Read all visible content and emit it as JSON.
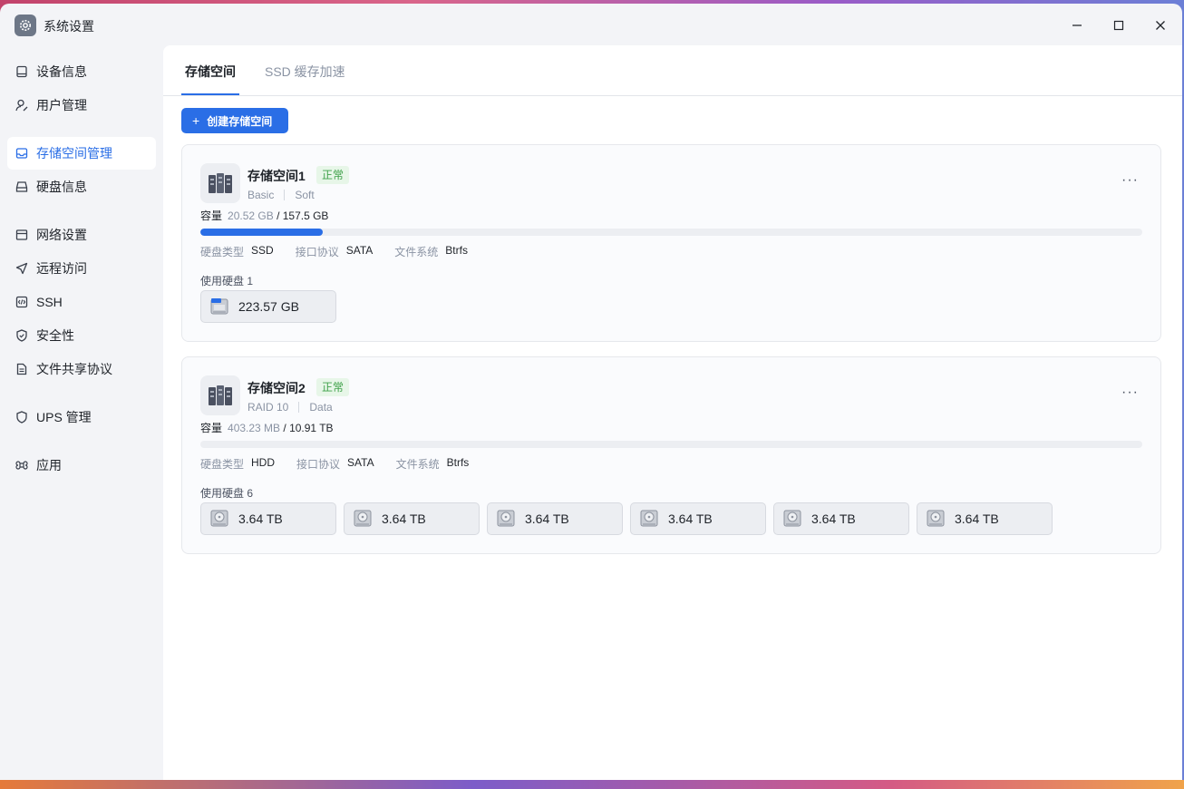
{
  "app": {
    "title": "系统设置",
    "icon": "gear-icon"
  },
  "window_controls": {
    "minimize": "minimize-icon",
    "maximize": "maximize-icon",
    "close": "close-icon"
  },
  "sidebar": {
    "items": [
      {
        "label": "设备信息",
        "icon": "device-icon",
        "active": false
      },
      {
        "label": "用户管理",
        "icon": "user-icon",
        "active": false
      },
      {
        "label": "存储空间管理",
        "icon": "storage-icon",
        "active": true
      },
      {
        "label": "硬盘信息",
        "icon": "hard-disk-icon",
        "active": false
      },
      {
        "label": "网络设置",
        "icon": "network-icon",
        "active": false
      },
      {
        "label": "远程访问",
        "icon": "send-icon",
        "active": false
      },
      {
        "label": "SSH",
        "icon": "code-icon",
        "active": false
      },
      {
        "label": "安全性",
        "icon": "shield-check-icon",
        "active": false
      },
      {
        "label": "文件共享协议",
        "icon": "file-icon",
        "active": false
      },
      {
        "label": "UPS 管理",
        "icon": "shield-icon",
        "active": false
      },
      {
        "label": "应用",
        "icon": "command-icon",
        "active": false
      }
    ]
  },
  "tabs": [
    {
      "label": "存储空间",
      "active": true
    },
    {
      "label": "SSD 缓存加速",
      "active": false
    }
  ],
  "create_button": {
    "label": "创建存储空间"
  },
  "accent_color": "#2a6ee6",
  "pools": [
    {
      "name": "存储空间1",
      "status": "正常",
      "raid": "Basic",
      "mode": "Soft",
      "capacity_label": "容量",
      "used": "20.52 GB",
      "total": "/ 157.5 GB",
      "usage_fraction": 0.13,
      "disk_type_label": "硬盘类型",
      "disk_type": "SSD",
      "interface_label": "接口协议",
      "interface": "SATA",
      "fs_label": "文件系统",
      "fs": "Btrfs",
      "disks_label": "使用硬盘 1",
      "disks": [
        {
          "size": "223.57 GB",
          "kind": "ssd"
        }
      ]
    },
    {
      "name": "存储空间2",
      "status": "正常",
      "raid": "RAID 10",
      "mode": "Data",
      "capacity_label": "容量",
      "used": "403.23 MB",
      "total": "/ 10.91 TB",
      "usage_fraction": 0.0,
      "disk_type_label": "硬盘类型",
      "disk_type": "HDD",
      "interface_label": "接口协议",
      "interface": "SATA",
      "fs_label": "文件系统",
      "fs": "Btrfs",
      "disks_label": "使用硬盘 6",
      "disks": [
        {
          "size": "3.64 TB",
          "kind": "hdd"
        },
        {
          "size": "3.64 TB",
          "kind": "hdd"
        },
        {
          "size": "3.64 TB",
          "kind": "hdd"
        },
        {
          "size": "3.64 TB",
          "kind": "hdd"
        },
        {
          "size": "3.64 TB",
          "kind": "hdd"
        },
        {
          "size": "3.64 TB",
          "kind": "hdd"
        }
      ]
    }
  ]
}
